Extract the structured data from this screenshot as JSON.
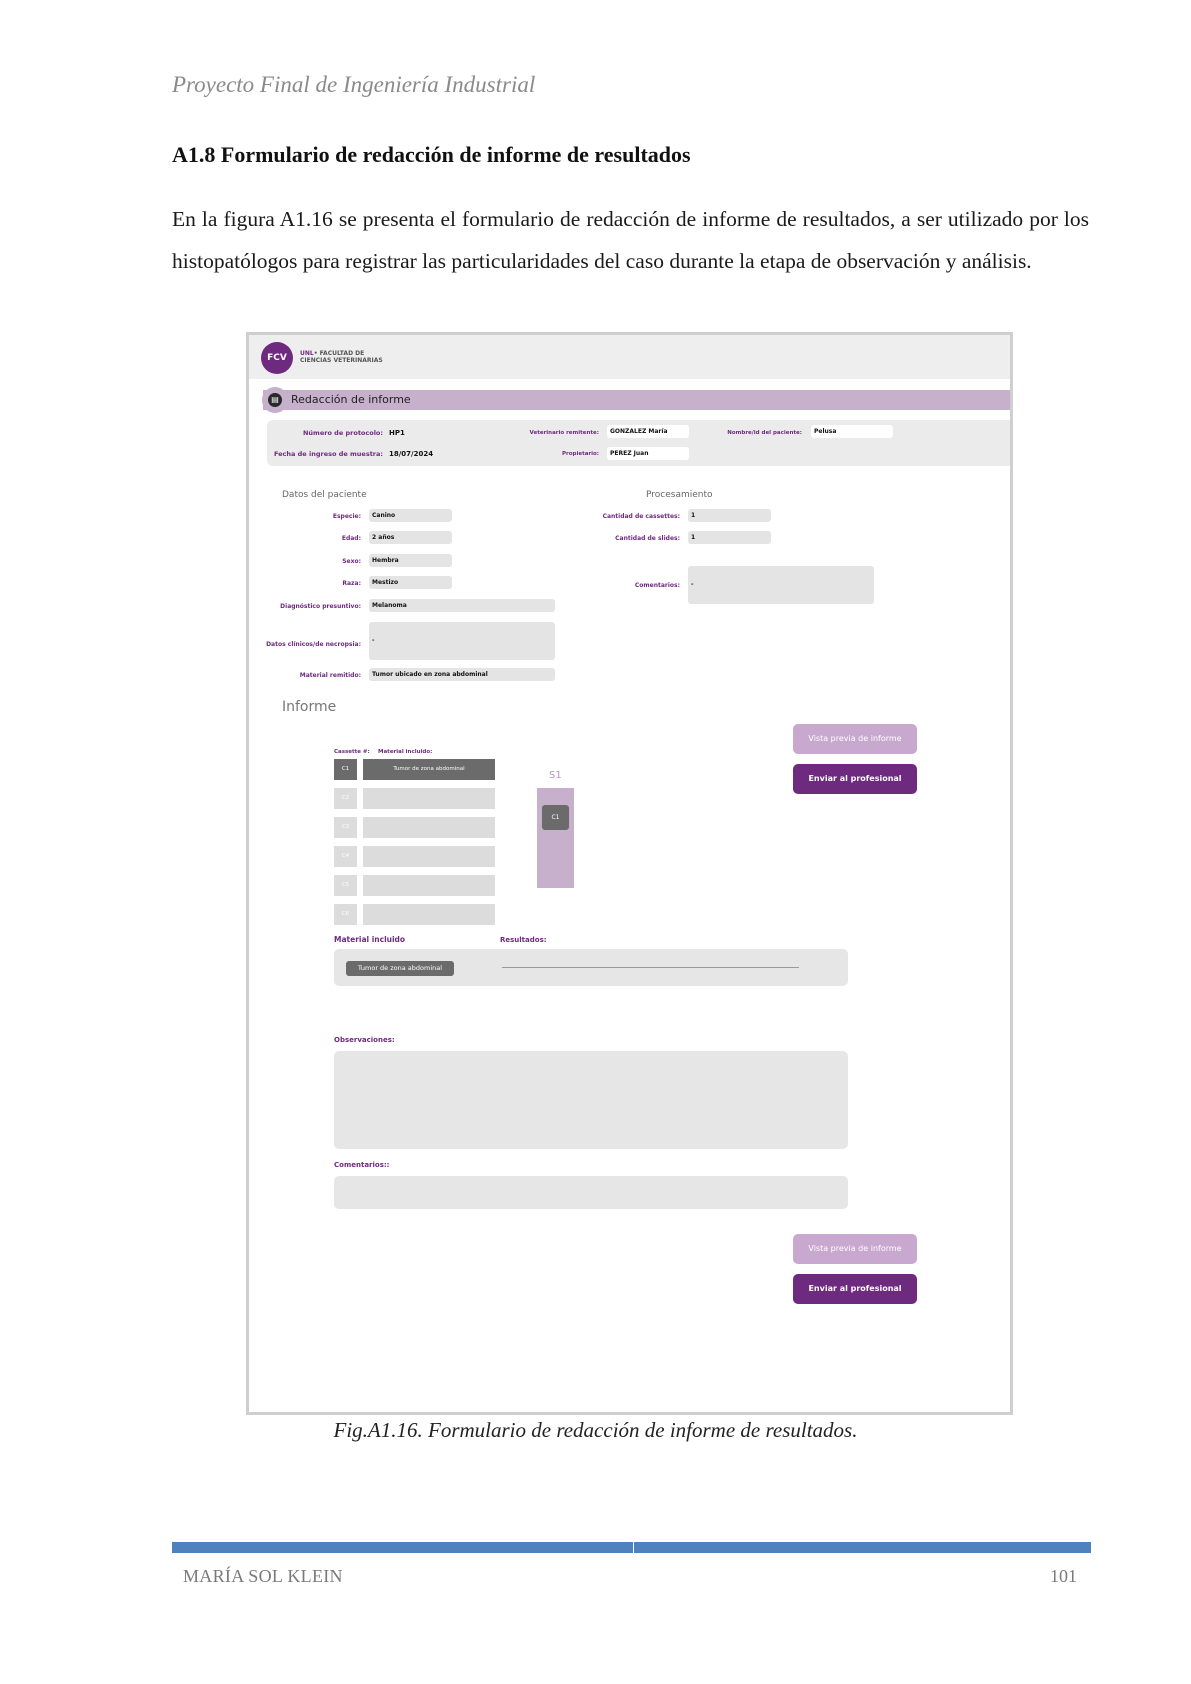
{
  "page": {
    "running_header": "Proyecto Final de Ingeniería Industrial",
    "section_heading": "A1.8 Formulario de redacción de informe de resultados",
    "intro": "En la figura A1.16 se presenta el formulario de redacción de informe de resultados, a ser utilizado por los histopatólogos para registrar las particularidades del caso durante la etapa de observación y análisis.",
    "caption": "Fig.A1.16. Formulario de redacción de informe de resultados.",
    "footer_author": "MARÍA SOL KLEIN",
    "page_number": "101",
    "footer_bar_color": "#4f81bd"
  },
  "form": {
    "brand": {
      "logo": "FCV",
      "unl": "UNL",
      "line1": "• FACULTAD DE",
      "line2": "CIENCIAS VETERINARIAS",
      "color": "#6e2a7e"
    },
    "title": "Redacción de informe",
    "title_icon": "document-icon",
    "header": {
      "protocolo_label": "Número de protocolo:",
      "protocolo_value": "HP1",
      "fecha_label": "Fecha de ingreso de muestra:",
      "fecha_value": "18/07/2024",
      "veterinario_label": "Veterinario remitente:",
      "veterinario_value": "GONZALEZ María",
      "propietario_label": "Propietario:",
      "propietario_value": "PEREZ Juan",
      "paciente_label": "Nombre/id del paciente:",
      "paciente_value": "Pelusa"
    },
    "datos_paciente": {
      "title": "Datos del paciente",
      "especie_label": "Especie:",
      "especie": "Canino",
      "edad_label": "Edad:",
      "edad": "2 años",
      "sexo_label": "Sexo:",
      "sexo": "Hembra",
      "raza_label": "Raza:",
      "raza": "Mestizo",
      "diagnostico_label": "Diagnóstico presuntivo:",
      "diagnostico": "Melanoma",
      "clinicos_label": "Datos clínicos/de necropsia:",
      "clinicos": "-",
      "material_label": "Material remitido:",
      "material": "Tumor ubicado en zona abdominal"
    },
    "procesamiento": {
      "title": "Procesamiento",
      "cassettes_label": "Cantidad de cassettes:",
      "cassettes": "1",
      "slides_label": "Cantidad de slides:",
      "slides": "1",
      "comentarios_label": "Comentarios:",
      "comentarios": "-"
    },
    "informe": {
      "title": "Informe",
      "preview_button": "Vista previa de informe",
      "send_button": "Enviar al profesional remitente",
      "cassette_header": "Cassette #:",
      "material_header": "Material incluido:",
      "cassettes": [
        {
          "id": "C1",
          "material": "Tumor de zona abdominal"
        },
        {
          "id": "C2",
          "material": ""
        },
        {
          "id": "C3",
          "material": ""
        },
        {
          "id": "C4",
          "material": ""
        },
        {
          "id": "C5",
          "material": ""
        },
        {
          "id": "C6",
          "material": ""
        }
      ],
      "slide_label": "S1",
      "slide_chip": "C1",
      "material_incluido_label": "Material incluido",
      "material_chip": "Tumor de zona abdominal",
      "resultados_label": "Resultados:",
      "observaciones_label": "Observaciones:",
      "comentarios_label": "Comentarios::"
    },
    "colors": {
      "accent": "#6e2a7e",
      "accent_light": "#c6b0cc",
      "field_bg": "#e6e6e6"
    }
  }
}
